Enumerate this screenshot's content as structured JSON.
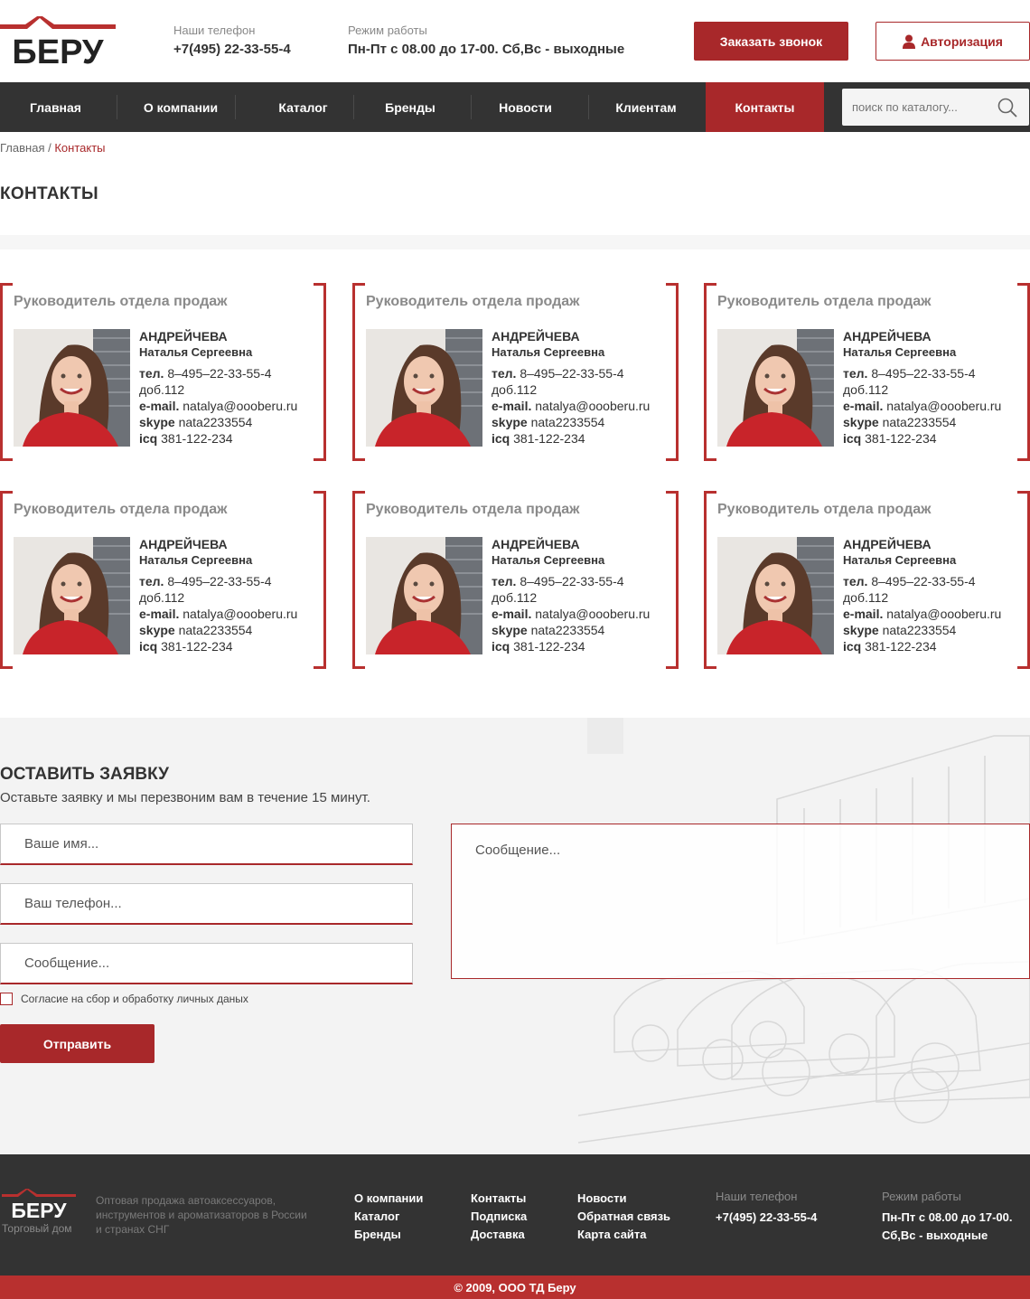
{
  "header": {
    "logo_text": "БЕРУ",
    "phone_label": "Наши телефон",
    "phone": "+7(495) 22-33-55-4",
    "hours_label": "Режим работы",
    "hours": "Пн-Пт с 08.00 до 17-00. Сб,Вс - выходные",
    "callback_button": "Заказать звонок",
    "auth_button": "Авторизация"
  },
  "nav": {
    "items": [
      "Главная",
      "О компании",
      "Каталог",
      "Бренды",
      "Новости",
      "Клиентам",
      "Контакты"
    ],
    "active": "Контакты",
    "search_placeholder": "поиск по каталогу..."
  },
  "breadcrumb": {
    "home": "Главная",
    "separator": "/",
    "current": "Контакты"
  },
  "page_title": "КОНТАКТЫ",
  "contacts": [
    {
      "role": "Руководитель отдела продаж",
      "last_name": "АНДРЕЙЧЕВА",
      "first_name": "Наталья Сергеевна",
      "tel_label": "тел.",
      "tel": "8–495–22-33-55-4",
      "ext": "доб.112",
      "email_label": "e-mail.",
      "email": "natalya@oooberu.ru",
      "skype_label": "skype",
      "skype": "nata2233554",
      "icq_label": "icq",
      "icq": "381-122-234"
    },
    {
      "role": "Руководитель отдела продаж",
      "last_name": "АНДРЕЙЧЕВА",
      "first_name": "Наталья Сергеевна",
      "tel_label": "тел.",
      "tel": "8–495–22-33-55-4",
      "ext": "доб.112",
      "email_label": "e-mail.",
      "email": "natalya@oooberu.ru",
      "skype_label": "skype",
      "skype": "nata2233554",
      "icq_label": "icq",
      "icq": "381-122-234"
    },
    {
      "role": "Руководитель отдела продаж",
      "last_name": "АНДРЕЙЧЕВА",
      "first_name": "Наталья Сергеевна",
      "tel_label": "тел.",
      "tel": "8–495–22-33-55-4",
      "ext": "доб.112",
      "email_label": "e-mail.",
      "email": "natalya@oooberu.ru",
      "skype_label": "skype",
      "skype": "nata2233554",
      "icq_label": "icq",
      "icq": "381-122-234"
    },
    {
      "role": "Руководитель отдела продаж",
      "last_name": "АНДРЕЙЧЕВА",
      "first_name": "Наталья Сергеевна",
      "tel_label": "тел.",
      "tel": "8–495–22-33-55-4",
      "ext": "доб.112",
      "email_label": "e-mail.",
      "email": "natalya@oooberu.ru",
      "skype_label": "skype",
      "skype": "nata2233554",
      "icq_label": "icq",
      "icq": "381-122-234"
    },
    {
      "role": "Руководитель отдела продаж",
      "last_name": "АНДРЕЙЧЕВА",
      "first_name": "Наталья Сергеевна",
      "tel_label": "тел.",
      "tel": "8–495–22-33-55-4",
      "ext": "доб.112",
      "email_label": "e-mail.",
      "email": "natalya@oooberu.ru",
      "skype_label": "skype",
      "skype": "nata2233554",
      "icq_label": "icq",
      "icq": "381-122-234"
    },
    {
      "role": "Руководитель отдела продаж",
      "last_name": "АНДРЕЙЧЕВА",
      "first_name": "Наталья Сергеевна",
      "tel_label": "тел.",
      "tel": "8–495–22-33-55-4",
      "ext": "доб.112",
      "email_label": "e-mail.",
      "email": "natalya@oooberu.ru",
      "skype_label": "skype",
      "skype": "nata2233554",
      "icq_label": "icq",
      "icq": "381-122-234"
    }
  ],
  "form": {
    "title": "ОСТАВИТЬ ЗАЯВКУ",
    "subtitle": "Оставьте заявку и мы перезвоним вам в течение 15 минут.",
    "name_placeholder": "Ваше имя...",
    "phone_placeholder": "Ваш телефон...",
    "message_placeholder": "Сообщение...",
    "textarea_placeholder": "Сообщение...",
    "consent": "Согласие на сбор и обработку личных даных",
    "consent_checked": false,
    "submit": "Отправить"
  },
  "footer": {
    "logo_text": "БЕРУ",
    "tagline": "Торговый дом",
    "description": "Оптовая продажа автоаксессуаров, инструментов и ароматизаторов в России и странах СНГ",
    "col1": [
      "О компании",
      "Каталог",
      "Бренды"
    ],
    "col2": [
      "Контакты",
      "Подписка",
      "Доставка"
    ],
    "col3": [
      "Новости",
      "Обратная связь",
      "Карта сайта"
    ],
    "phone_label": "Наши телефон",
    "phone": "+7(495) 22-33-55-4",
    "hours_label": "Режим работы",
    "hours_line1": "Пн-Пт с 08.00 до 17-00.",
    "hours_line2": "Сб,Вс - выходные",
    "copyright": "© 2009, ООО ТД Беру"
  },
  "colors": {
    "accent": "#a8282a",
    "dark": "#333333",
    "light_bg": "#f3f3f3"
  }
}
